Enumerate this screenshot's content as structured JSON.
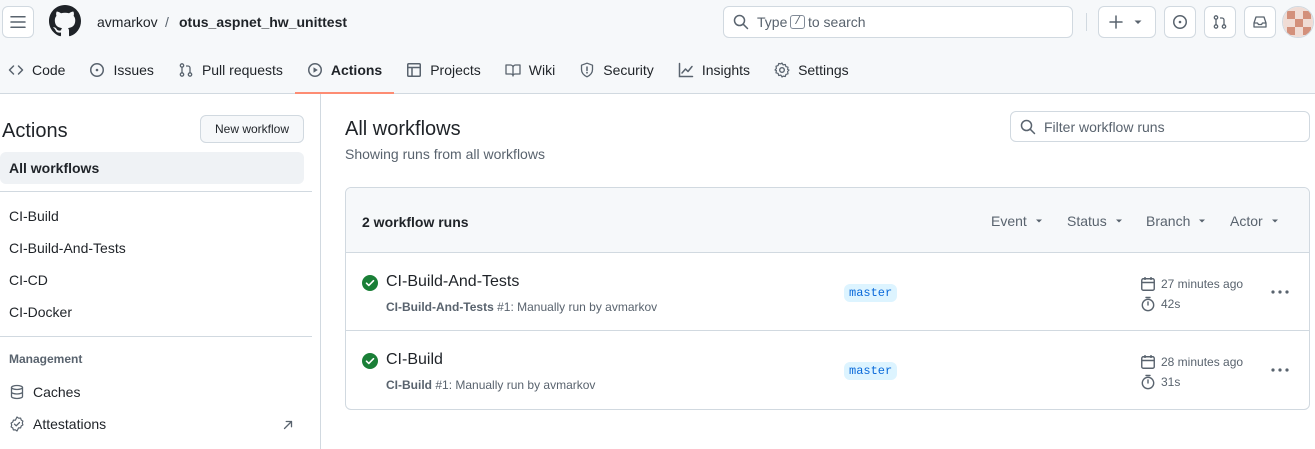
{
  "header": {
    "owner": "avmarkov",
    "separator": "/",
    "repo": "otus_aspnet_hw_unittest",
    "search_prefix": "Type",
    "search_key": "/",
    "search_suffix": "to search"
  },
  "tabs": [
    {
      "label": "Code",
      "icon": "code-icon"
    },
    {
      "label": "Issues",
      "icon": "issue-icon"
    },
    {
      "label": "Pull requests",
      "icon": "pull-request-icon"
    },
    {
      "label": "Actions",
      "icon": "play-icon",
      "selected": true
    },
    {
      "label": "Projects",
      "icon": "table-icon"
    },
    {
      "label": "Wiki",
      "icon": "book-icon"
    },
    {
      "label": "Security",
      "icon": "shield-icon"
    },
    {
      "label": "Insights",
      "icon": "graph-icon"
    },
    {
      "label": "Settings",
      "icon": "gear-icon"
    }
  ],
  "sidebar": {
    "title": "Actions",
    "new_workflow": "New workflow",
    "all_workflows": "All workflows",
    "workflows": [
      "CI-Build",
      "CI-Build-And-Tests",
      "CI-CD",
      "CI-Docker"
    ],
    "management_heading": "Management",
    "caches": "Caches",
    "attestations": "Attestations"
  },
  "main": {
    "title": "All workflows",
    "subtitle": "Showing runs from all workflows",
    "filter_placeholder": "Filter workflow runs",
    "runs_count": "2 workflow runs",
    "filters": [
      "Event",
      "Status",
      "Branch",
      "Actor"
    ],
    "runs": [
      {
        "title": "CI-Build-And-Tests",
        "workflow": "CI-Build-And-Tests",
        "detail": "#1: Manually run by avmarkov",
        "branch": "master",
        "time": "27 minutes ago",
        "duration": "42s"
      },
      {
        "title": "CI-Build",
        "workflow": "CI-Build",
        "detail": "#1: Manually run by avmarkov",
        "branch": "master",
        "time": "28 minutes ago",
        "duration": "31s"
      }
    ]
  },
  "colors": {
    "accent": "#fd8c73",
    "success": "#1a7f37",
    "link": "#0969da"
  }
}
